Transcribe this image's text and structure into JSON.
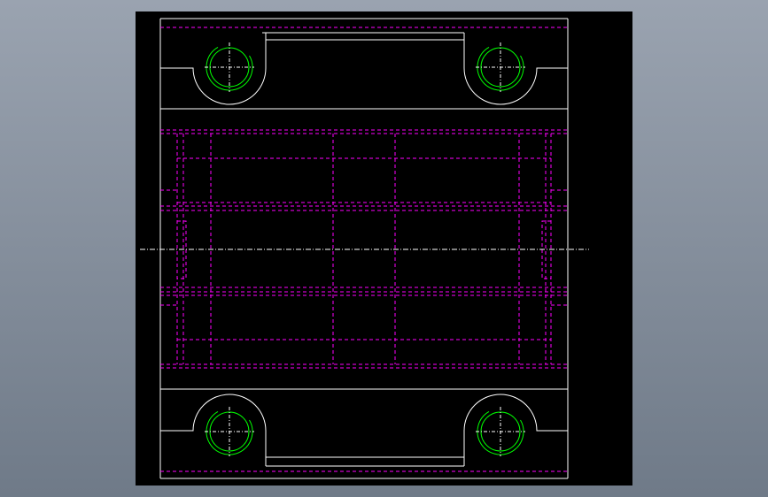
{
  "viewport": {
    "background_top": "#9aa3b0",
    "background_bottom": "#6f7a88"
  },
  "drawing": {
    "canvas_color": "#000000",
    "outline_color": "#ffffff",
    "hidden_line_color": "#ff00ff",
    "hole_color": "#00ff00",
    "centerline_color": "#ffffff",
    "upper_mounting_holes": 2,
    "lower_mounting_holes": 2
  }
}
